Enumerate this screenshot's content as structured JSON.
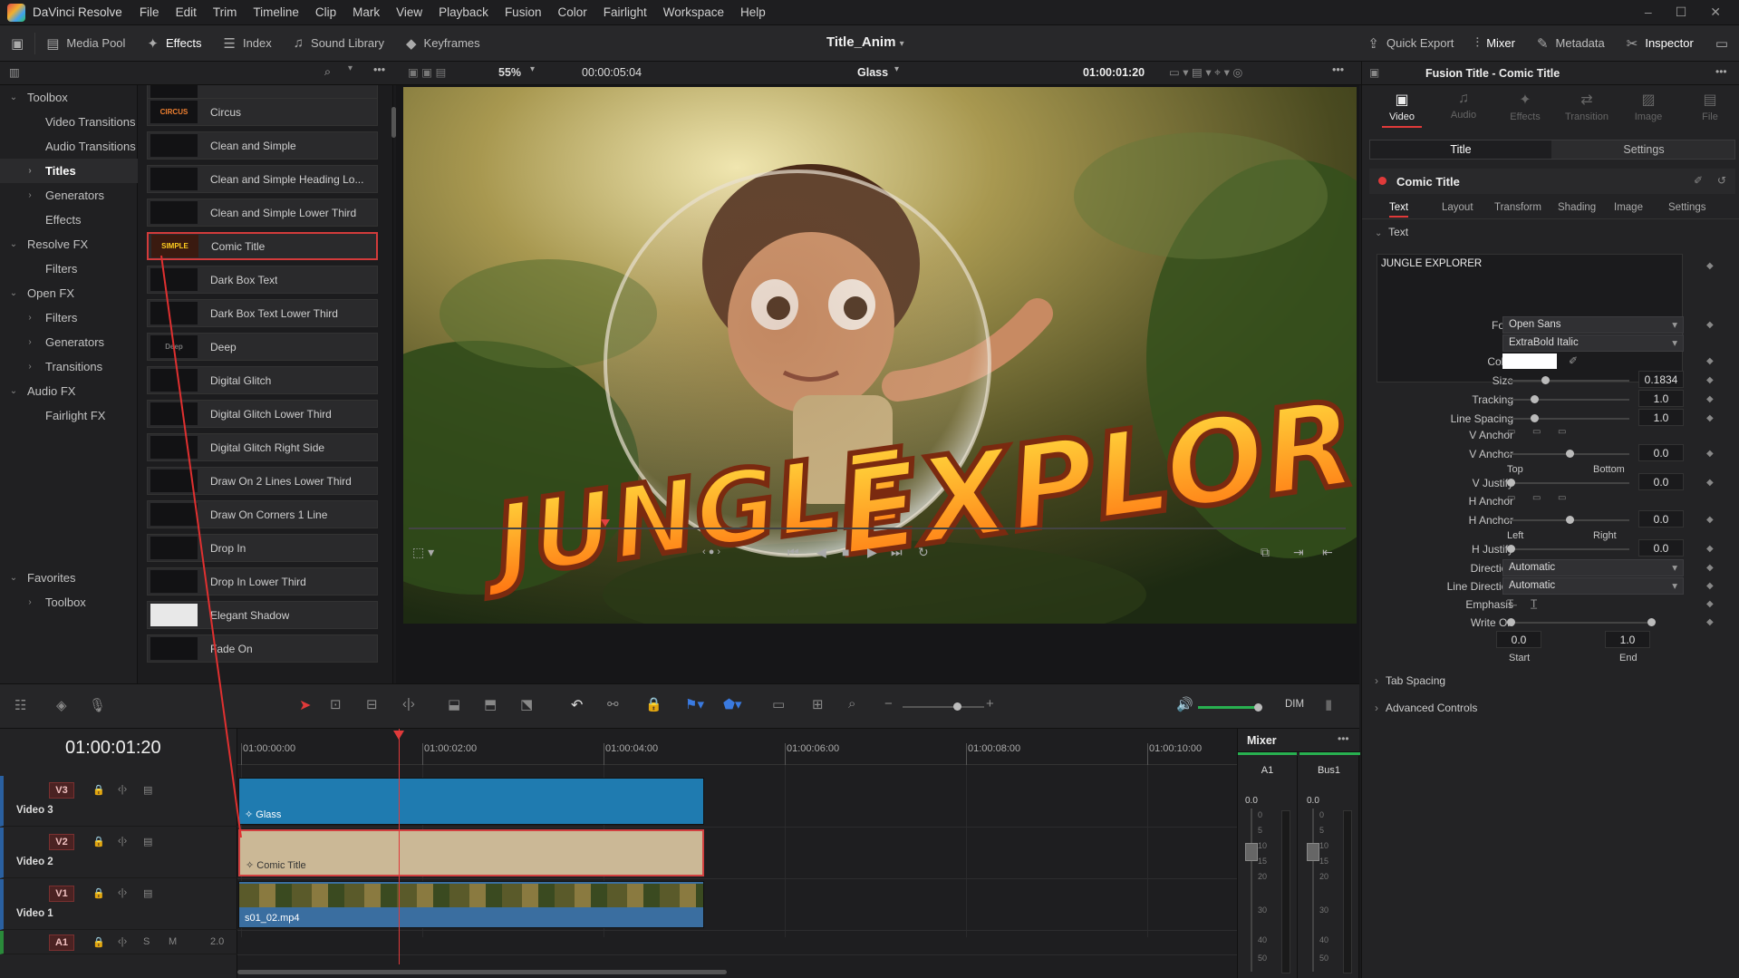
{
  "app": {
    "name": "DaVinci Resolve"
  },
  "menu": [
    "File",
    "Edit",
    "Trim",
    "Timeline",
    "Clip",
    "Mark",
    "View",
    "Playback",
    "Fusion",
    "Color",
    "Fairlight",
    "Workspace",
    "Help"
  ],
  "window_controls": [
    "–",
    "☐",
    "✕"
  ],
  "toolbar": {
    "media_pool": "Media Pool",
    "effects": "Effects",
    "index": "Index",
    "sound_library": "Sound Library",
    "keyframes": "Keyframes",
    "project_title": "Title_Anim",
    "quick_export": "Quick Export",
    "mixer": "Mixer",
    "metadata": "Metadata",
    "inspector": "Inspector"
  },
  "viewer_bar": {
    "zoom": "55%",
    "duration": "00:00:05:04",
    "clip_name": "Glass",
    "timecode": "01:00:01:20"
  },
  "left_tree": [
    {
      "label": "Toolbox",
      "level": 0,
      "expanded": true
    },
    {
      "label": "Video Transitions",
      "level": 1
    },
    {
      "label": "Audio Transitions",
      "level": 1
    },
    {
      "label": "Titles",
      "level": 1,
      "selected": true,
      "chev": true
    },
    {
      "label": "Generators",
      "level": 1,
      "chev": true
    },
    {
      "label": "Effects",
      "level": 1
    },
    {
      "label": "Resolve FX",
      "level": 0,
      "expanded": true
    },
    {
      "label": "Filters",
      "level": 1
    },
    {
      "label": "Open FX",
      "level": 0,
      "expanded": true
    },
    {
      "label": "Filters",
      "level": 1,
      "chev": true
    },
    {
      "label": "Generators",
      "level": 1,
      "chev": true
    },
    {
      "label": "Transitions",
      "level": 1,
      "chev": true
    },
    {
      "label": "Audio FX",
      "level": 0,
      "expanded": true
    },
    {
      "label": "Fairlight FX",
      "level": 1
    }
  ],
  "favorites": [
    {
      "label": "Favorites",
      "level": 0,
      "expanded": true
    },
    {
      "label": "Toolbox",
      "level": 1,
      "chev": true
    }
  ],
  "titles_list": [
    {
      "name": "Circus",
      "thumb": "CIRCUS"
    },
    {
      "name": "Clean and Simple",
      "thumb": ""
    },
    {
      "name": "Clean and Simple Heading Lo...",
      "thumb": ""
    },
    {
      "name": "Clean and Simple Lower Third",
      "thumb": ""
    },
    {
      "name": "Comic Title",
      "thumb": "SIMPLE",
      "selected": true
    },
    {
      "name": "Dark Box Text",
      "thumb": ""
    },
    {
      "name": "Dark Box Text Lower Third",
      "thumb": ""
    },
    {
      "name": "Deep",
      "thumb": "Deep"
    },
    {
      "name": "Digital Glitch",
      "thumb": ""
    },
    {
      "name": "Digital Glitch Lower Third",
      "thumb": ""
    },
    {
      "name": "Digital Glitch Right Side",
      "thumb": ""
    },
    {
      "name": "Draw On 2 Lines Lower Third",
      "thumb": ""
    },
    {
      "name": "Draw On Corners 1 Line",
      "thumb": ""
    },
    {
      "name": "Drop In",
      "thumb": ""
    },
    {
      "name": "Drop In Lower Third",
      "thumb": ""
    },
    {
      "name": "Elegant Shadow",
      "thumb": ""
    },
    {
      "name": "Fade On",
      "thumb": ""
    }
  ],
  "video_overlay": {
    "line1": "JUNGLE",
    "line2": "EXPLORER"
  },
  "inspector": {
    "header": "Fusion Title - Comic Title",
    "tabs": [
      "Video",
      "Audio",
      "Effects",
      "Transition",
      "Image",
      "File"
    ],
    "subtabs": [
      "Title",
      "Settings"
    ],
    "effect_name": "Comic Title",
    "sections": [
      "Text",
      "Layout",
      "Transform",
      "Shading",
      "Image",
      "Settings"
    ],
    "text_group": "Text",
    "text_value": "JUNGLE EXPLORER",
    "font_label": "Font",
    "font": "Open Sans",
    "style": "ExtraBold Italic",
    "color_label": "Color",
    "color": "#ffffff",
    "params": [
      {
        "label": "Size",
        "value": "0.1834",
        "pos": 0.29
      },
      {
        "label": "Tracking",
        "value": "1.0",
        "pos": 0.2
      },
      {
        "label": "Line Spacing",
        "value": "1.0",
        "pos": 0.2
      }
    ],
    "vanchor_label": "V Anchor",
    "vanchor2": {
      "label": "V Anchor",
      "value": "0.0",
      "pos": 0.5,
      "left": "Top",
      "right": "Bottom"
    },
    "vjustify": {
      "label": "V Justify",
      "value": "0.0",
      "pos": 0.0
    },
    "hanchor_label": "H Anchor",
    "hanchor2": {
      "label": "H Anchor",
      "value": "0.0",
      "pos": 0.5,
      "left": "Left",
      "right": "Right"
    },
    "hjustify": {
      "label": "H Justify",
      "value": "0.0",
      "pos": 0.0
    },
    "direction_label": "Direction",
    "direction": "Automatic",
    "line_direction_label": "Line Direction",
    "line_direction": "Automatic",
    "emphasis_label": "Emphasis",
    "write_on_label": "Write On",
    "write_on_start": "0.0",
    "write_on_end": "1.0",
    "start_label": "Start",
    "end_label": "End",
    "tab_spacing": "Tab Spacing",
    "advanced": "Advanced Controls"
  },
  "timeline": {
    "timecode": "01:00:01:20",
    "ruler": [
      "01:00:00:00",
      "01:00:02:00",
      "01:00:04:00",
      "01:00:06:00",
      "01:00:08:00",
      "01:00:10:00"
    ],
    "tracks": [
      {
        "tag": "V3",
        "name": "Video 3",
        "clip": "Glass"
      },
      {
        "tag": "V2",
        "name": "Video 2",
        "clip": "Comic Title"
      },
      {
        "tag": "V1",
        "name": "Video 1",
        "clip": "s01_02.mp4"
      },
      {
        "tag": "A1",
        "name": "",
        "clip": "",
        "channels": "2.0"
      }
    ],
    "dim_label": "DIM"
  },
  "mixer": {
    "title": "Mixer",
    "channels": [
      "A1",
      "Bus1"
    ],
    "levels": [
      "0.0",
      "0.0"
    ],
    "scale": [
      "0",
      "5",
      "10",
      "15",
      "20",
      "30",
      "40",
      "50"
    ]
  }
}
